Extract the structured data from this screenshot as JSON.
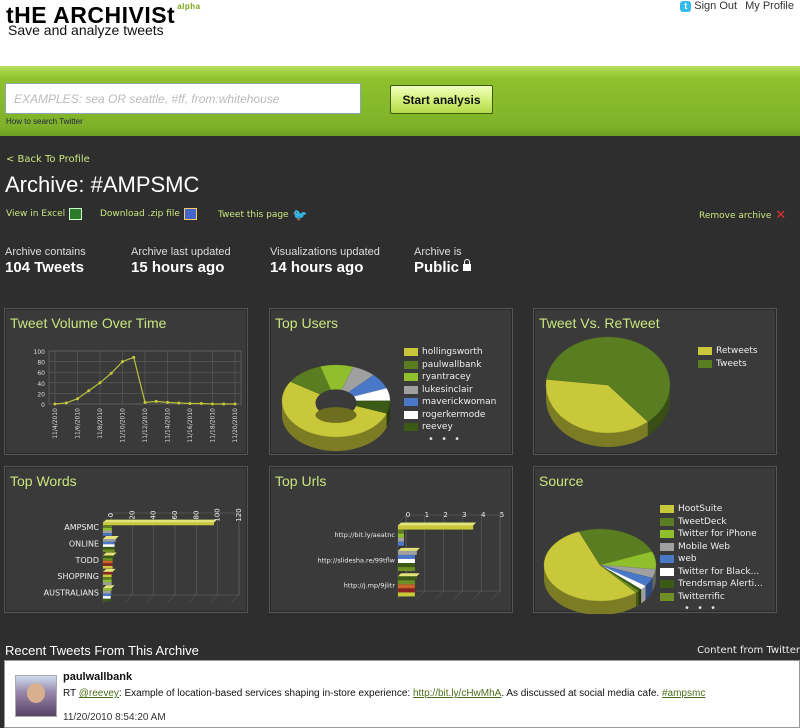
{
  "header": {
    "logo": "tHE ARCHIVISt",
    "badge": "alpha",
    "tagline": "Save and analyze tweets",
    "sign_out": "Sign Out",
    "my_profile": "My Profile"
  },
  "search": {
    "placeholder": "EXAMPLES: sea OR seattle, #ff, from:whitehouse",
    "howto": "How to search Twitter",
    "button": "Start analysis"
  },
  "archive": {
    "back": "< Back To Profile",
    "title": "Archive: #AMPSMC",
    "actions": {
      "excel": "View in Excel",
      "zip": "Download .zip file",
      "tweet": "Tweet this page",
      "remove": "Remove archive"
    },
    "stats": [
      {
        "label": "Archive contains",
        "value": "104 Tweets"
      },
      {
        "label": "Archive last updated",
        "value": "15 hours ago"
      },
      {
        "label": "Visualizations updated",
        "value": "14 hours ago"
      },
      {
        "label": "Archive is",
        "value": "Public"
      }
    ]
  },
  "panels": {
    "volume": "Tweet Volume Over Time",
    "users": "Top Users",
    "retweet": "Tweet Vs. ReTweet",
    "words": "Top Words",
    "urls": "Top Urls",
    "source": "Source"
  },
  "colors": {
    "accent": "#c9e67f",
    "yellow": "#c8c83a",
    "green": "#5b7d22",
    "lime": "#8fbf2c"
  },
  "chart_data": [
    {
      "type": "line",
      "x": [
        "11/4/2010",
        "11/5/2010",
        "11/6/2010",
        "11/7/2010",
        "11/8/2010",
        "11/9/2010",
        "11/10/2010",
        "11/11/2010",
        "11/12/2010",
        "11/13/2010",
        "11/14/2010",
        "11/15/2010",
        "11/16/2010",
        "11/17/2010",
        "11/18/2010",
        "11/19/2010",
        "11/20/2010"
      ],
      "tick_labels": [
        "11/4/2010",
        "11/6/2010",
        "11/8/2010",
        "11/10/2010",
        "11/12/2010",
        "11/14/2010",
        "11/16/2010",
        "11/18/2010",
        "11/20/2010"
      ],
      "values": [
        0,
        2,
        10,
        25,
        40,
        58,
        80,
        88,
        3,
        5,
        3,
        2,
        1,
        1,
        0,
        0,
        0
      ],
      "y_ticks": [
        "0",
        "20",
        "40",
        "60",
        "80",
        "100"
      ],
      "ylim": [
        0,
        100
      ]
    },
    {
      "type": "pie",
      "labels": [
        "hollingsworth",
        "paulwallbank",
        "ryantracey",
        "lukesinclair",
        "maverickwoman",
        "rogerkermode",
        "reevey"
      ],
      "values": [
        38,
        8,
        7,
        5,
        5,
        4,
        4
      ],
      "colors": [
        "#c8c83a",
        "#5b7d22",
        "#8fbf2c",
        "#a0a0a0",
        "#4a78c8",
        "#ffffff",
        "#3b5a16"
      ],
      "more": "• • •"
    },
    {
      "type": "pie",
      "labels": [
        "Retweets",
        "Tweets"
      ],
      "values": [
        38,
        62
      ],
      "colors": [
        "#c8c83a",
        "#5b7d22"
      ]
    },
    {
      "type": "bar",
      "orientation": "horizontal",
      "categories": [
        "AMPSMC",
        "ONLINE",
        "TODD",
        "SHOPPING",
        "AUSTRALIANS"
      ],
      "values": [
        104,
        12,
        10,
        9,
        8
      ],
      "x_ticks": [
        "0",
        "20",
        "40",
        "60",
        "80",
        "100",
        "120"
      ],
      "xlim": [
        0,
        120
      ]
    },
    {
      "type": "bar",
      "orientation": "horizontal",
      "categories": [
        "http://bit.ly/aeatnc",
        "http://slidesha.re/99tflw",
        "http://j.mp/9jlitr"
      ],
      "values": [
        4,
        1,
        1
      ],
      "x_ticks": [
        "0",
        "1",
        "2",
        "3",
        "4",
        "5"
      ],
      "xlim": [
        0,
        5
      ]
    },
    {
      "type": "pie",
      "labels": [
        "HootSuite",
        "TweetDeck",
        "Twitter for iPhone",
        "Mobile Web",
        "web",
        "Twitter for Black...",
        "Trendsmap Alerti...",
        "Twitterrific"
      ],
      "values": [
        55,
        25,
        8,
        4,
        4,
        2,
        1,
        1
      ],
      "colors": [
        "#c8c83a",
        "#5b7d22",
        "#8fbf2c",
        "#a0a0a0",
        "#4a78c8",
        "#ffffff",
        "#3b5a16",
        "#6e8f24"
      ],
      "more": "• • •"
    }
  ],
  "recent": {
    "title": "Recent Tweets From This Archive",
    "content_from": "Content from Twitter",
    "tweet": {
      "user": "paulwallbank",
      "rt": "RT ",
      "mention": "@reevey",
      "text1": ": Example of location-based services shaping in-store experience: ",
      "link": "http://bit.ly/cHwMhA",
      "text2": ". As discussed at social media cafe. ",
      "hashtag": "#ampsmc",
      "time": "11/20/2010 8:54:20 AM"
    }
  }
}
